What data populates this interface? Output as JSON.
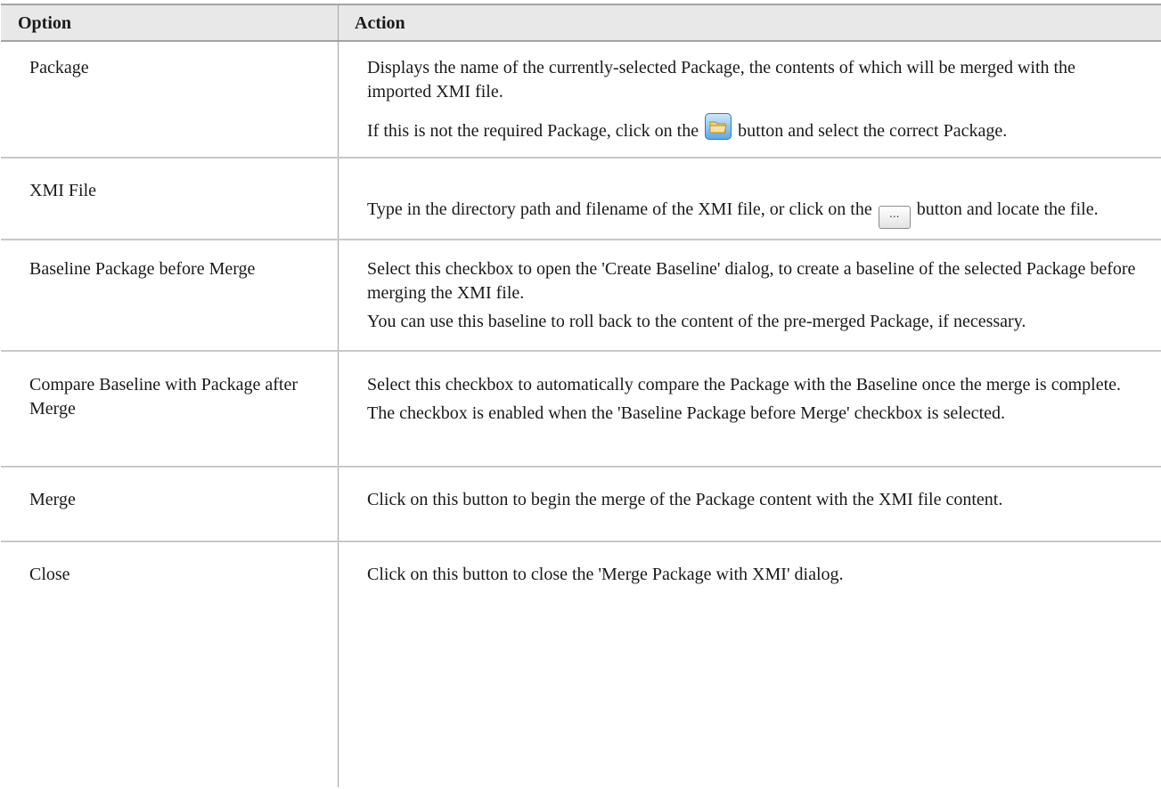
{
  "header": {
    "option": "Option",
    "action": "Action"
  },
  "rows": [
    {
      "option": "Package",
      "action_1": "Displays the name of the currently-selected Package, the contents of which will be merged with the imported XMI file.",
      "action_2_before": "If this is not the required Package, click on the",
      "action_2_after": "button and select the correct Package.",
      "icon": "folder-open-icon"
    },
    {
      "option": "XMI File",
      "action_1_before": "Type in the directory path and filename of the XMI file, or click on the",
      "action_1_after": "button and locate the file.",
      "icon": "ellipsis-button-icon",
      "icon_label": "..."
    },
    {
      "option": "Baseline Package before Merge",
      "action_1": "Select this checkbox to open the 'Create Baseline' dialog, to create a baseline of the selected Package before merging the XMI file.",
      "action_2": "You can use this baseline to roll back to the content of the pre-merged Package, if necessary."
    },
    {
      "option": "Compare Baseline with Package after Merge",
      "action_1": "Select this checkbox to automatically compare the Package with the Baseline once the merge is complete.",
      "action_2": "The checkbox is enabled when the 'Baseline Package before Merge' checkbox is selected."
    },
    {
      "option": "Merge",
      "action_1": "Click on this button to begin the merge of the Package content with the XMI file content."
    },
    {
      "option": "Close",
      "action_1": "Click on this button to close the 'Merge Package with XMI' dialog."
    }
  ]
}
